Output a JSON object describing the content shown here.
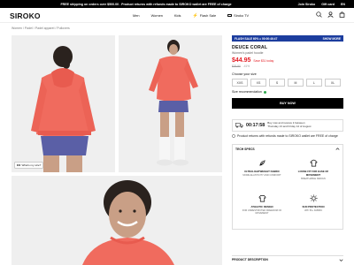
{
  "topbar": {
    "message": "FREE shipping on orders over $500.00 . Product returns with refunds made to SIROKO wallet are FREE of charge",
    "links": [
      "Join Siroko",
      "Gift card",
      "EN"
    ]
  },
  "header": {
    "logo": "SIROKO",
    "nav": [
      "Men",
      "Women",
      "Kids",
      "Flash Sale",
      "Siroko TV"
    ]
  },
  "breadcrumb": "Women / Padel / Padel apparel / Pullovers",
  "gallery": {
    "whats_my_size": "What's my size?"
  },
  "product": {
    "flash_label": "FLASH SALE 60% ● 00:00:46:47",
    "show_more": "SHOW MORE",
    "name": "DEUCE CORAL",
    "subtitle": "Women's padel hoodie",
    "price": "$44.95",
    "save": "Save $31 today",
    "old_price": "$76.90",
    "old_discount": "-41%",
    "choose_size": "Choose your size",
    "sizes": [
      "XXS",
      "XS",
      "S",
      "M",
      "L",
      "XL"
    ],
    "size_rec": "Size recommendation",
    "buy_label": "BUY NOW",
    "timer": "00:17:58",
    "ship_line1": "Buy now and receive it between",
    "ship_line2": "Thursday 13 and Friday 14 of August",
    "returns": "Product returns with refunds made to SIROKO wallet are FREE of charge",
    "tech_title": "TECH SPECS",
    "features": [
      {
        "title": "ULTRALIGHTWEIGHT FABRIC",
        "sub": "MORE ELASTICITY AND COMFORT"
      },
      {
        "title": "LOOSE FIT FOR EASE OF MOVEMENT",
        "sub": "BREATHABLE DESIGN"
      },
      {
        "title": "ATHLETIC DESIGN",
        "sub": "FOR UNRESTRICTED FREEDOM OF MOVEMENT"
      },
      {
        "title": "SUN PROTECTION",
        "sub": "UPF 50+ FABRIC"
      }
    ],
    "description_label": "PRODUCT DESCRIPTION"
  },
  "colors": {
    "accent_red": "#e31b23",
    "flash_blue": "#1c3d9e",
    "coral": "#f06b5e"
  }
}
